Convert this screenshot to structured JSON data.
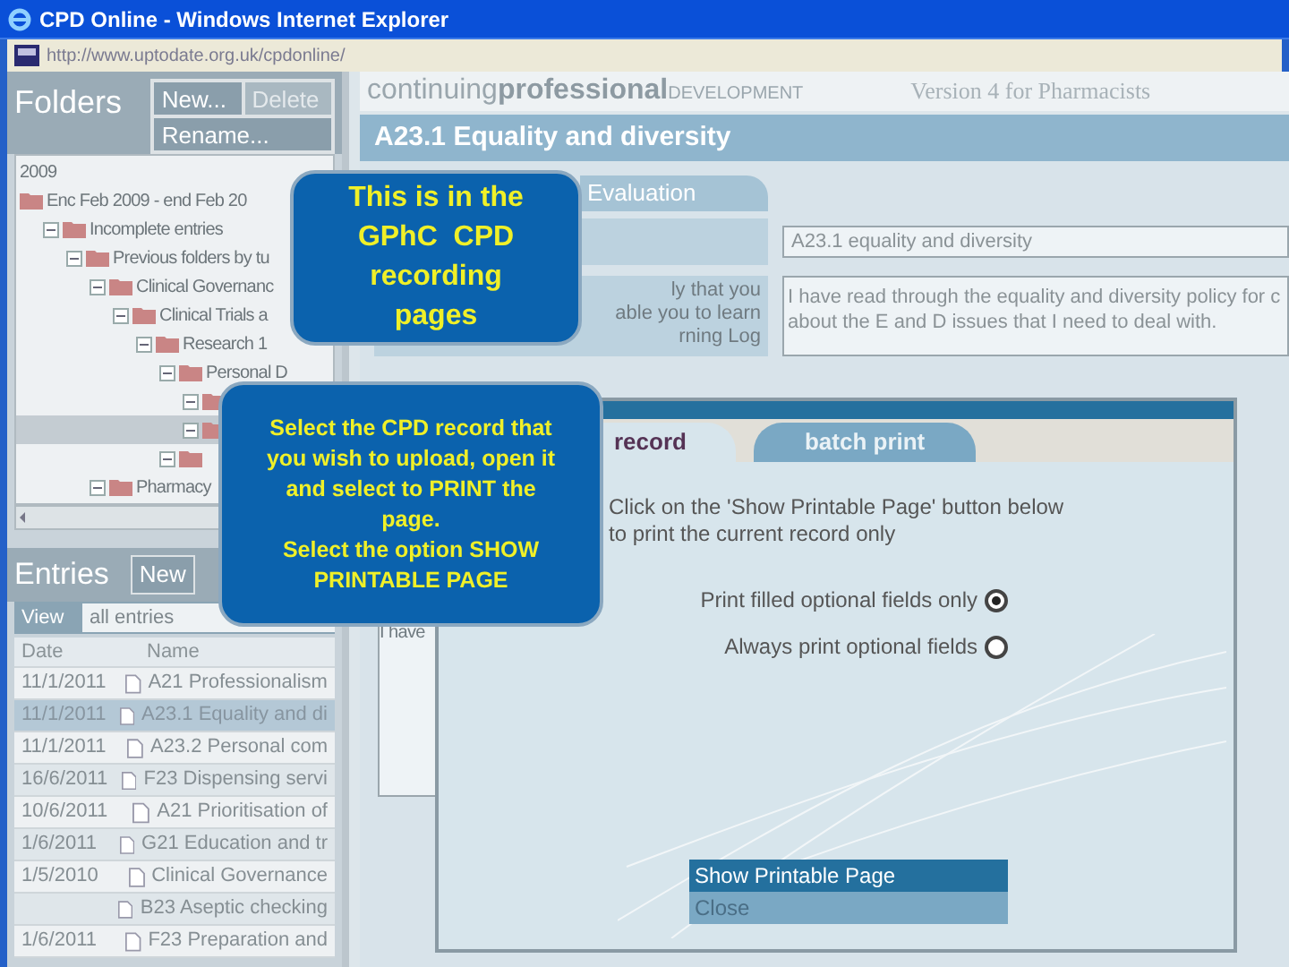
{
  "window": {
    "title": "CPD Online - Windows Internet Explorer"
  },
  "address_bar": {
    "url": "http://www.uptodate.org.uk/cpdonline/"
  },
  "folders": {
    "title": "Folders",
    "buttons": [
      {
        "label": "New...",
        "disabled": false
      },
      {
        "label": "Delete",
        "disabled": true
      },
      {
        "label": "Rename...",
        "disabled": false
      }
    ],
    "tree": [
      {
        "label": "2009",
        "kind": "text",
        "selected": false
      },
      {
        "label": "Enc Feb 2009 - end Feb 20",
        "kind": "folder",
        "selected": false,
        "children": [
          {
            "label": "Incomplete entries",
            "kind": "folder",
            "selected": false,
            "children": [
              {
                "label": "Previous folders by tu",
                "kind": "folder",
                "selected": false,
                "children": [
                  {
                    "label": "Clinical Governanc",
                    "kind": "folder",
                    "selected": false,
                    "children": [
                      {
                        "label": "Clinical Trials a",
                        "kind": "folder",
                        "selected": false,
                        "children": [
                          {
                            "label": "Research 1",
                            "kind": "folder",
                            "selected": false,
                            "children": [
                              {
                                "label": "Personal D",
                                "kind": "folder",
                                "selected": false,
                                "children": [
                                  {
                                    "kind": "folder",
                                    "selected": false
                                  },
                                  {
                                    "kind": "folder",
                                    "selected": true
                                  }
                                ]
                              },
                              {
                                "kind": "folder",
                                "selected": false
                              }
                            ]
                          }
                        ]
                      }
                    ]
                  },
                  {
                    "label": "Pharmacy",
                    "kind": "folder",
                    "selected": false
                  }
                ]
              }
            ]
          }
        ]
      }
    ]
  },
  "entries": {
    "title": "Entries",
    "new_button": "New",
    "view_label": "View",
    "view_value": "all entries",
    "columns": [
      "Date",
      "Name"
    ],
    "rows": [
      {
        "date": "11/1/2011",
        "name": "A21 Professionalism",
        "selected": false
      },
      {
        "date": "11/1/2011",
        "name": "A23.1 Equality and di",
        "selected": true
      },
      {
        "date": "11/1/2011",
        "name": "A23.2 Personal com",
        "selected": false
      },
      {
        "date": "16/6/2011",
        "name": "F23 Dispensing servi",
        "selected": false
      },
      {
        "date": "10/6/2011",
        "name": "A21 Prioritisation of",
        "selected": false
      },
      {
        "date": "1/6/2011",
        "name": "G21 Education and tr",
        "selected": false
      },
      {
        "date": "1/5/2010",
        "name": "Clinical Governance",
        "selected": false
      },
      {
        "date": "",
        "name": "B23 Aseptic checking",
        "selected": false
      },
      {
        "date": "1/6/2011",
        "name": "F23 Preparation and",
        "selected": false
      }
    ]
  },
  "header": {
    "logo_light": "continuing",
    "logo_bold": "professional",
    "logo_caps": "DEVELOPMENT",
    "version": "Version 4 for Pharmacists"
  },
  "record": {
    "title": "A23.1 Equality and diversity",
    "tab": "Evaluation",
    "label_lines": [
      "ly that you",
      "able you to learn",
      "rning Log"
    ],
    "title_value": "A23.1 equality and diversity",
    "text_lines": [
      "I have read through the equality and diversity policy for c",
      "about the E and D issues that I need to deal with."
    ],
    "lower_text": "I have"
  },
  "dialog": {
    "tabs": [
      {
        "label": "record",
        "selected": true
      },
      {
        "label": "batch print",
        "selected": false
      }
    ],
    "instructions": [
      "Click on the 'Show Printable Page' button below",
      "to print the current record only"
    ],
    "options": [
      {
        "label": "Print filled optional fields only",
        "selected": true
      },
      {
        "label": "Always print optional fields",
        "selected": false
      }
    ],
    "buttons": [
      {
        "label": "Show Printable Page",
        "kind": "primary"
      },
      {
        "label": "Close",
        "kind": "secondary"
      }
    ]
  },
  "callouts": [
    {
      "lines": [
        "This is in the",
        "GPhC  CPD",
        "recording",
        "pages"
      ]
    },
    {
      "lines": [
        "Select the CPD record that",
        "you wish to upload, open it",
        "and select to PRINT the",
        "page.",
        "Select the option SHOW",
        "PRINTABLE PAGE"
      ]
    }
  ]
}
